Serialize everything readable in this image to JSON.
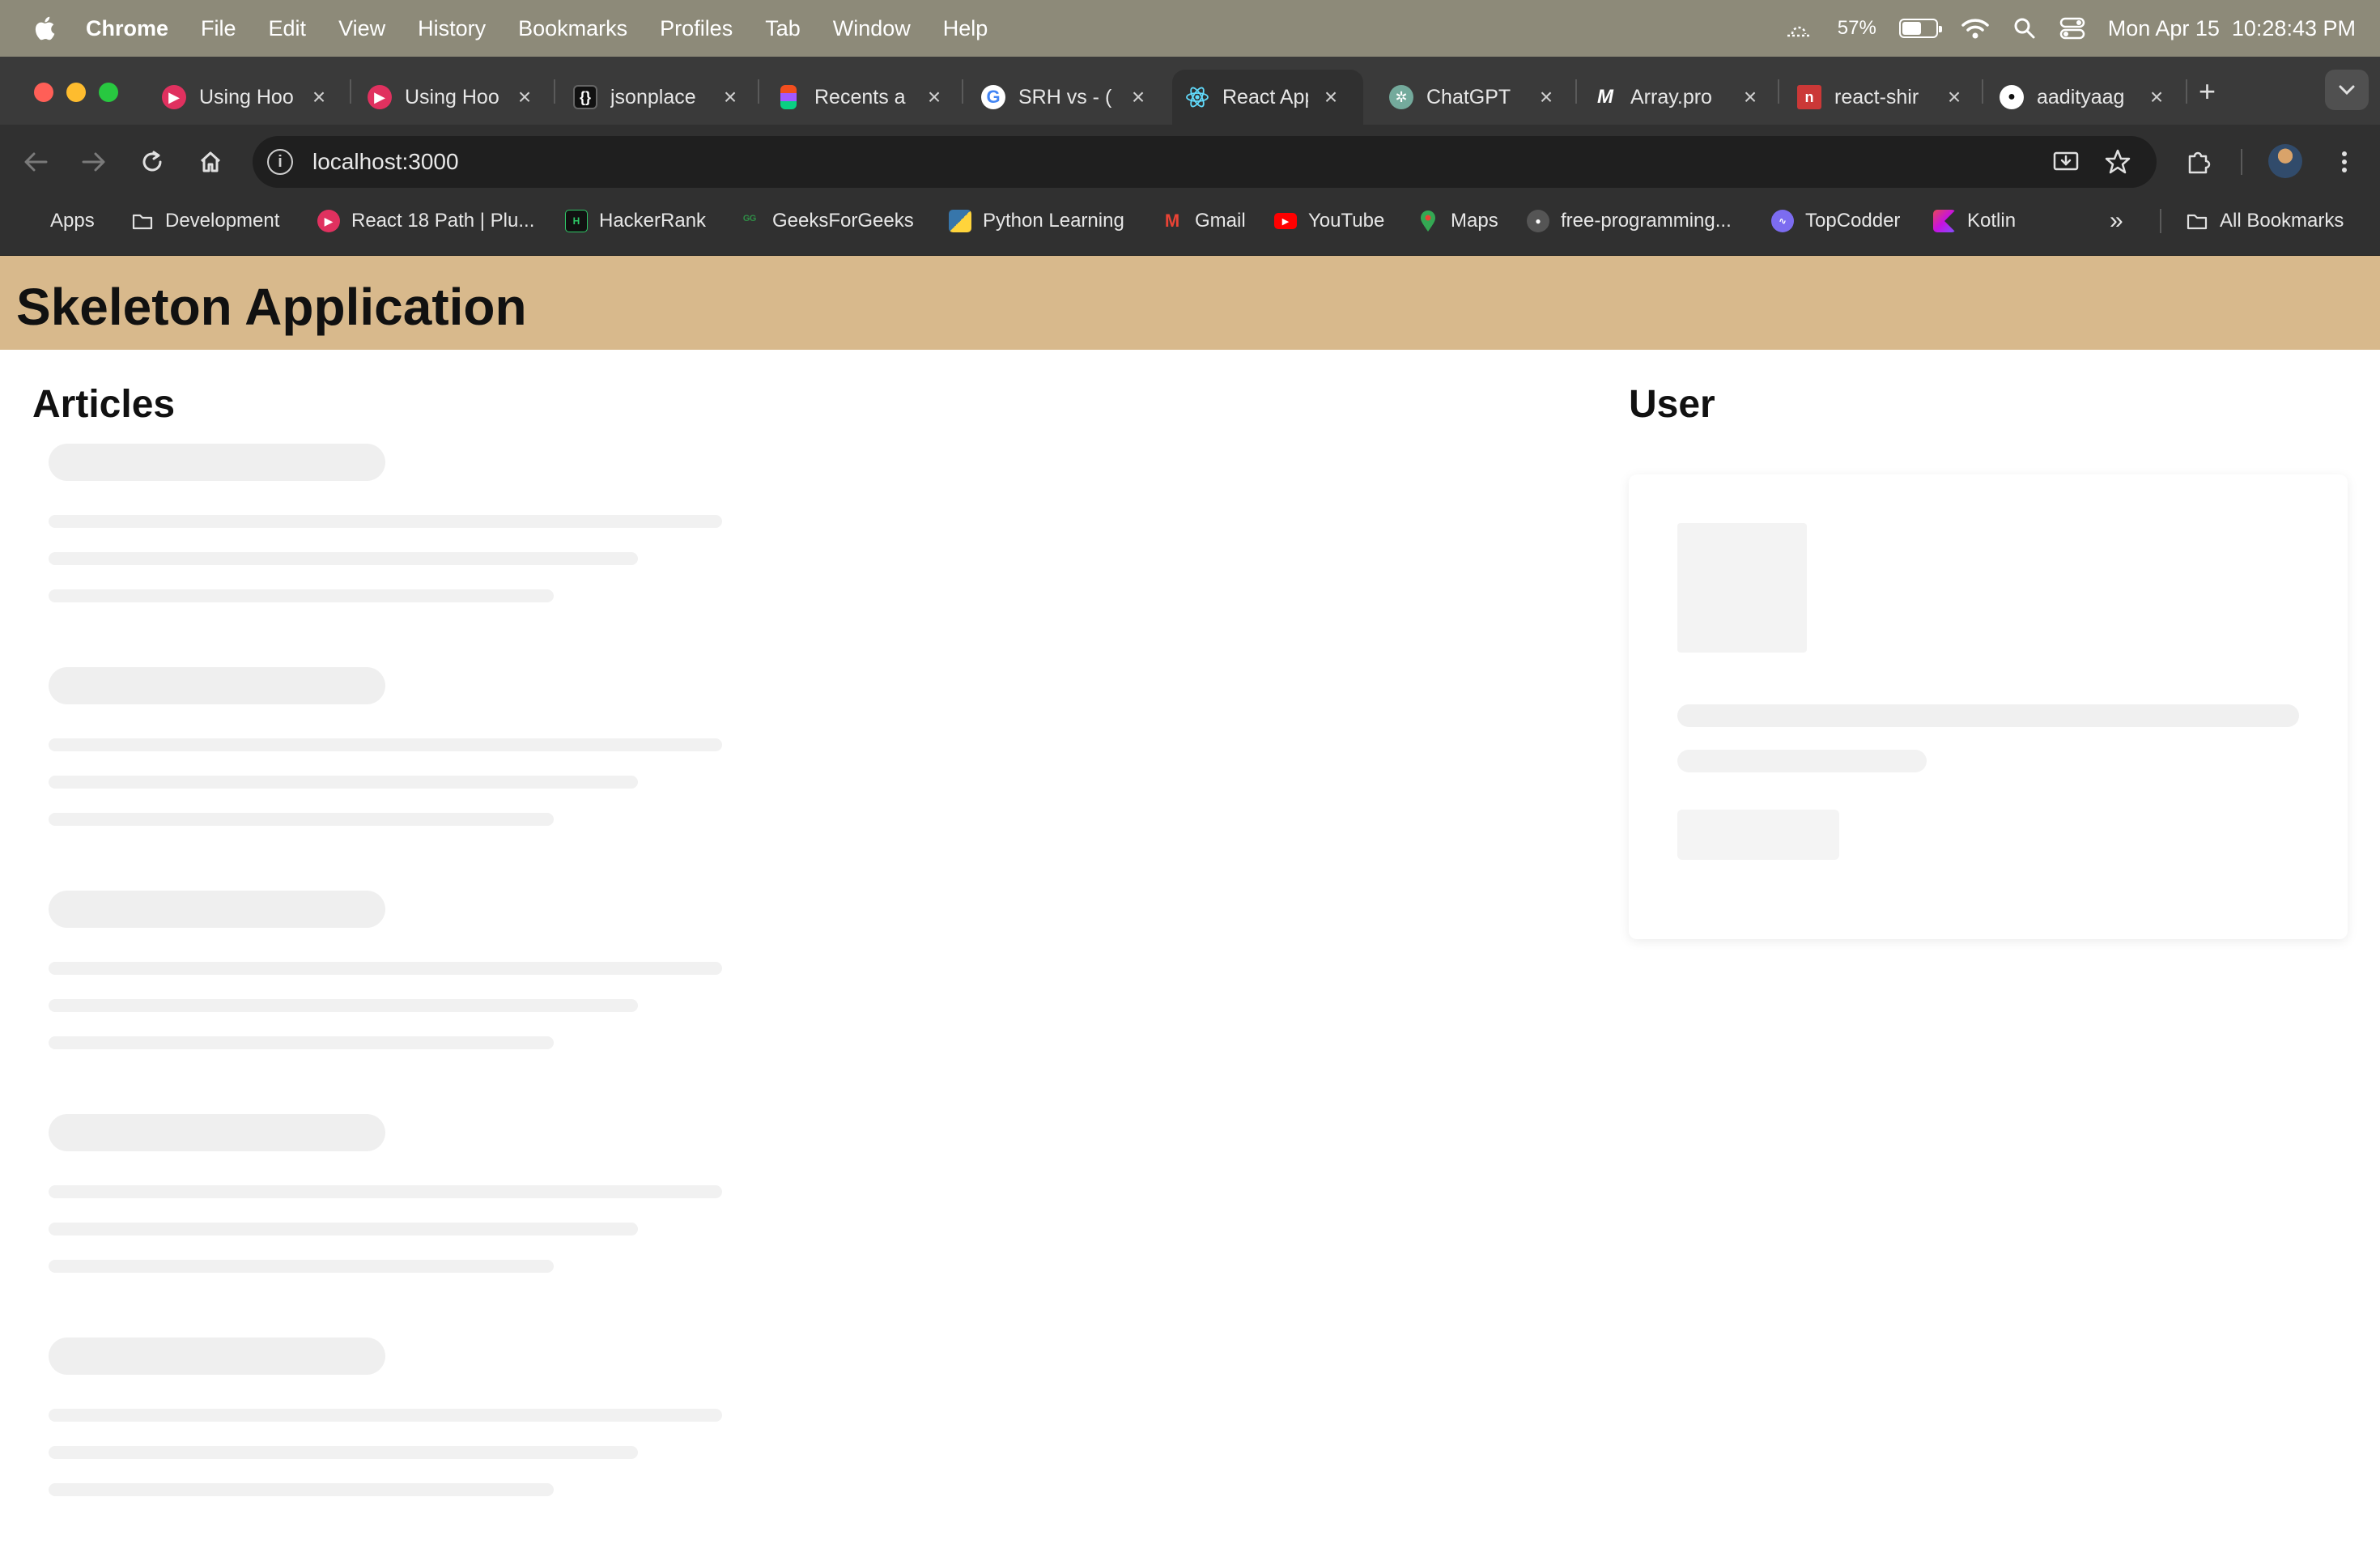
{
  "menubar": {
    "app_name": "Chrome",
    "menus": [
      "File",
      "Edit",
      "View",
      "History",
      "Bookmarks",
      "Profiles",
      "Tab",
      "Window",
      "Help"
    ],
    "battery_percent": "57%",
    "battery_level": 0.57,
    "datetime": "Mon Apr 15  10:28:43 PM"
  },
  "tabs": [
    {
      "label": "Using Hoo",
      "icon": "scrimba-icon",
      "color": "#e0315f"
    },
    {
      "label": "Using Hoo",
      "icon": "scrimba-icon",
      "color": "#e0315f"
    },
    {
      "label": "jsonplace",
      "icon": "jsonplaceholder-icon",
      "color": "#1f1f1f"
    },
    {
      "label": "Recents a",
      "icon": "figma-icon",
      "color": "#a259ff"
    },
    {
      "label": "SRH vs - (",
      "icon": "google-icon",
      "color": "#ffffff"
    },
    {
      "label": "React App",
      "icon": "react-icon",
      "color": "#61dafb",
      "active": true
    },
    {
      "label": "ChatGPT",
      "icon": "chatgpt-icon",
      "color": "#74aa9c"
    },
    {
      "label": "Array.pro",
      "icon": "mdn-icon",
      "color": "#1f1f1f"
    },
    {
      "label": "react-shir",
      "icon": "npm-icon",
      "color": "#cb3837"
    },
    {
      "label": "aadityaag",
      "icon": "github-icon",
      "color": "#ffffff"
    }
  ],
  "toolbar": {
    "url": "localhost:3000"
  },
  "bookmarks": [
    {
      "label": "Apps",
      "icon": "apps-grid-icon"
    },
    {
      "label": "Development",
      "icon": "folder-icon"
    },
    {
      "label": "React 18 Path | Plu...",
      "icon": "scrimba-icon"
    },
    {
      "label": "HackerRank",
      "icon": "hackerrank-icon"
    },
    {
      "label": "GeeksForGeeks",
      "icon": "geeksforgeeks-icon"
    },
    {
      "label": "Python Learning",
      "icon": "python-learning-icon"
    },
    {
      "label": "Gmail",
      "icon": "gmail-icon"
    },
    {
      "label": "YouTube",
      "icon": "youtube-icon"
    },
    {
      "label": "Maps",
      "icon": "maps-icon"
    },
    {
      "label": "free-programming...",
      "icon": "github-icon"
    },
    {
      "label": "TopCodder",
      "icon": "topcoder-icon"
    },
    {
      "label": "Kotlin",
      "icon": "kotlin-icon"
    }
  ],
  "all_bookmarks_label": "All Bookmarks",
  "page": {
    "title": "Skeleton Application",
    "articles_heading": "Articles",
    "user_heading": "User",
    "header_color": "#d8b98c"
  }
}
